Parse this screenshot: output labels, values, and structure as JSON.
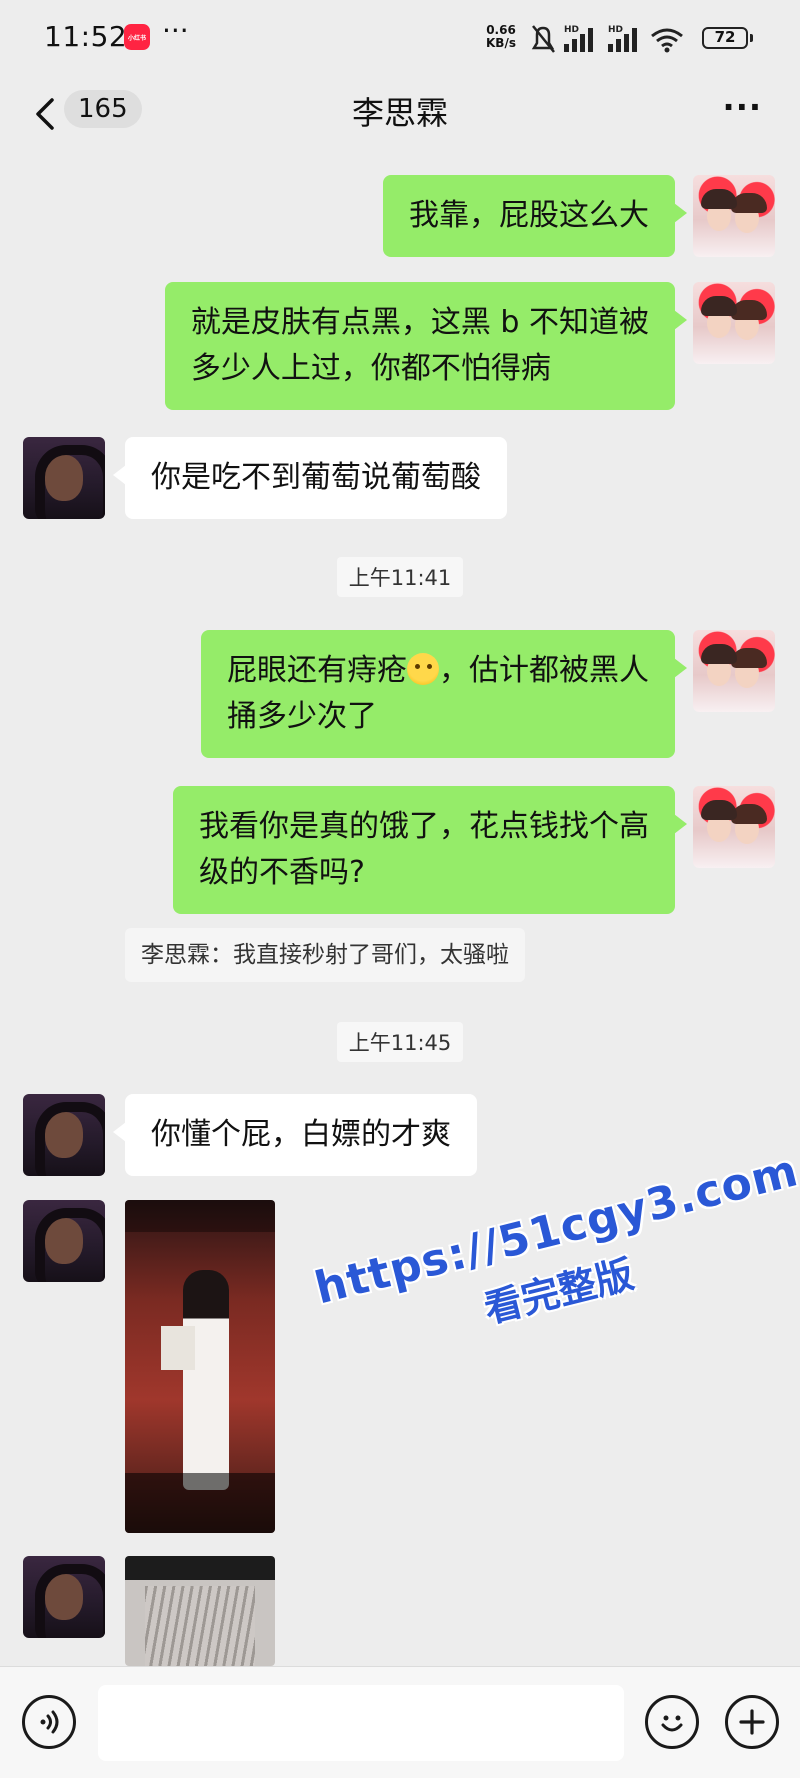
{
  "status_bar": {
    "time": "11:52",
    "app_badge": "小红书",
    "more": "···",
    "net_speed": "0.66",
    "net_unit": "KB/s",
    "signal1": "HD",
    "signal2": "HD",
    "battery": "72"
  },
  "nav": {
    "back_count": "165",
    "title": "李思霖",
    "more": "···"
  },
  "messages": [
    {
      "side": "me",
      "text": "我靠，屁股这么大"
    },
    {
      "side": "me",
      "text_lines": [
        "就是皮肤有点黑，这黑 b 不知道被",
        "多少人上过，你都不怕得病"
      ]
    },
    {
      "side": "her",
      "text": "你是吃不到葡萄说葡萄酸"
    },
    {
      "type": "time",
      "text": "上午11:41"
    },
    {
      "side": "me",
      "text_lines": [
        "屁眼还有痔疮",
        "，估计都被黑人",
        "捅多少次了"
      ],
      "emoji": "woozy-face"
    },
    {
      "side": "me",
      "text_lines": [
        "我看你是真的饿了，花点钱找个高",
        "级的不香吗?"
      ]
    },
    {
      "type": "quote",
      "text": "李思霖：我直接秒射了哥们，太骚啦"
    },
    {
      "type": "time",
      "text": "上午11:45"
    },
    {
      "side": "her",
      "text": "你懂个屁，白嫖的才爽"
    },
    {
      "side": "her",
      "type": "image"
    },
    {
      "side": "her",
      "type": "image"
    }
  ],
  "watermark": {
    "url": "https://51cgy3.com",
    "sub": "看完整版"
  },
  "input": {
    "value": "",
    "placeholder": ""
  },
  "colors": {
    "my_bubble": "#95ec69",
    "her_bubble": "#ffffff",
    "background": "#ededed",
    "watermark": "#2a58d6"
  }
}
